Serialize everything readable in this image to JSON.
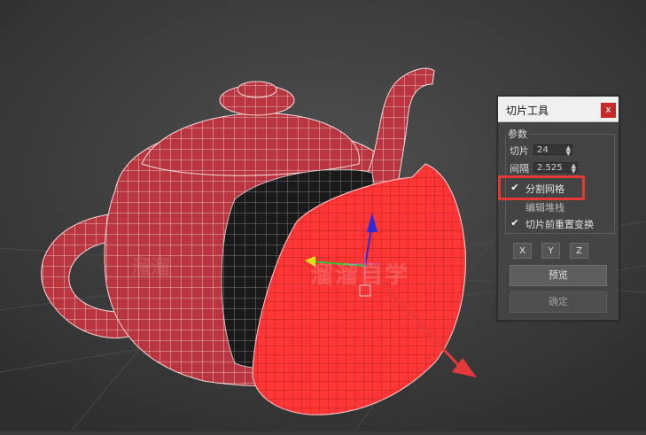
{
  "dialog": {
    "title": "切片工具",
    "close_label": "x",
    "group_label": "参数",
    "slices_label": "切片",
    "slices_value": "24",
    "spacing_label": "间隔",
    "spacing_value": "2.525",
    "split_mesh_label": "分割网格",
    "split_mesh_checked": true,
    "hidden_option_label": "编辑堆栈",
    "reset_transform_label": "切片前重置变换",
    "reset_transform_checked": true,
    "axis_x": "X",
    "axis_y": "Y",
    "axis_z": "Z",
    "preview_label": "预览",
    "confirm_label": "确定"
  },
  "watermark": "溜溜自学",
  "colors": {
    "viewport_bg": "#3b3b3b",
    "mesh_red": "#c0303a",
    "slice_red": "#ff3b3b",
    "highlight_red": "#e53935",
    "wire": "#ffffff"
  },
  "icons": [
    "close-icon",
    "checkmark-icon",
    "move-gizmo-icon",
    "arrow-icon"
  ]
}
